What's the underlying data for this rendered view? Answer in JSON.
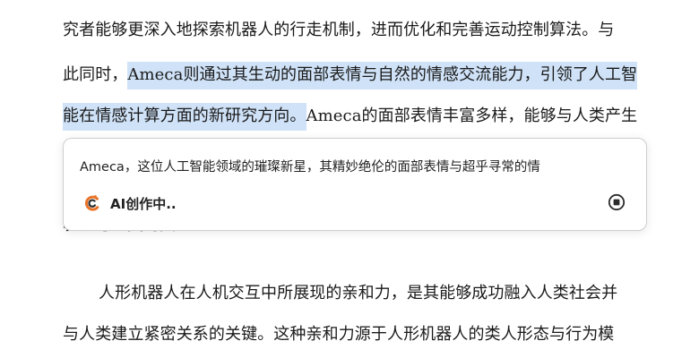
{
  "document": {
    "line1": "究者能够更深入地探索机器人的行走机制，进而优化和完善运动控制算法。与",
    "line2_prefix": "此同时，",
    "line2_highlight": "Ameca则通过其生动的面部表情与自然的情感交流能力，引领了人工智",
    "line3_highlight": "能在情感计算方面的新研究方向。",
    "line3_suffix": "Ameca的面部表情丰富多样，能够与人类产生",
    "hidden_line": "表达与人类的交互",
    "para2_line1": "人形机器人在人机交互中所展现的亲和力，是其能够成功融入人类社会并",
    "para2_line2": "与人类建立紧密关系的关键。这种亲和力源于人形机器人的类人形态与行为模"
  },
  "ai_panel": {
    "preview_text": "Ameca，这位人工智能领域的璀璨新星，其精妙绝伦的面部表情与超乎寻常的情",
    "status_label": "AI创作中..",
    "logo_icon": "ai-swirl-icon",
    "stop_icon": "stop-circle-icon"
  },
  "colors": {
    "highlight": "#cfe2f7",
    "logo_orange": "#e8742a",
    "logo_dark": "#2b2b2b"
  }
}
